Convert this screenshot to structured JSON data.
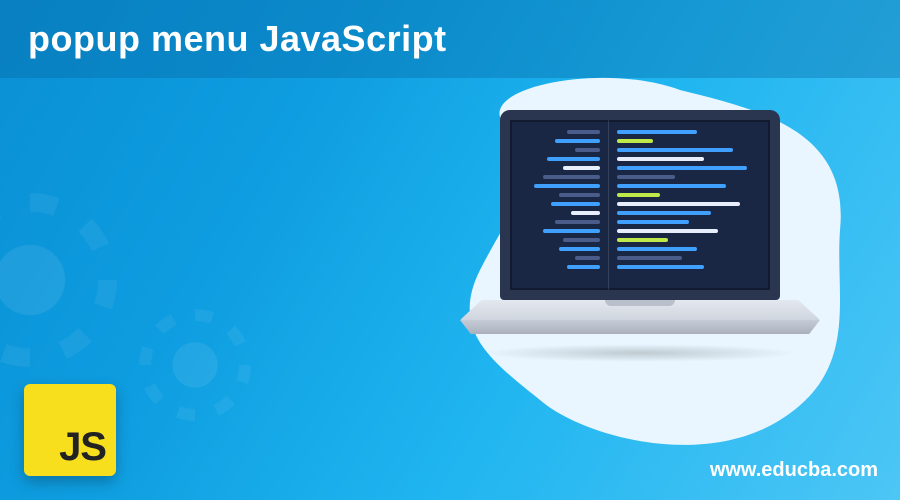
{
  "title": "popup menu JavaScript",
  "badge_text": "JS",
  "website_url": "www.educba.com"
}
